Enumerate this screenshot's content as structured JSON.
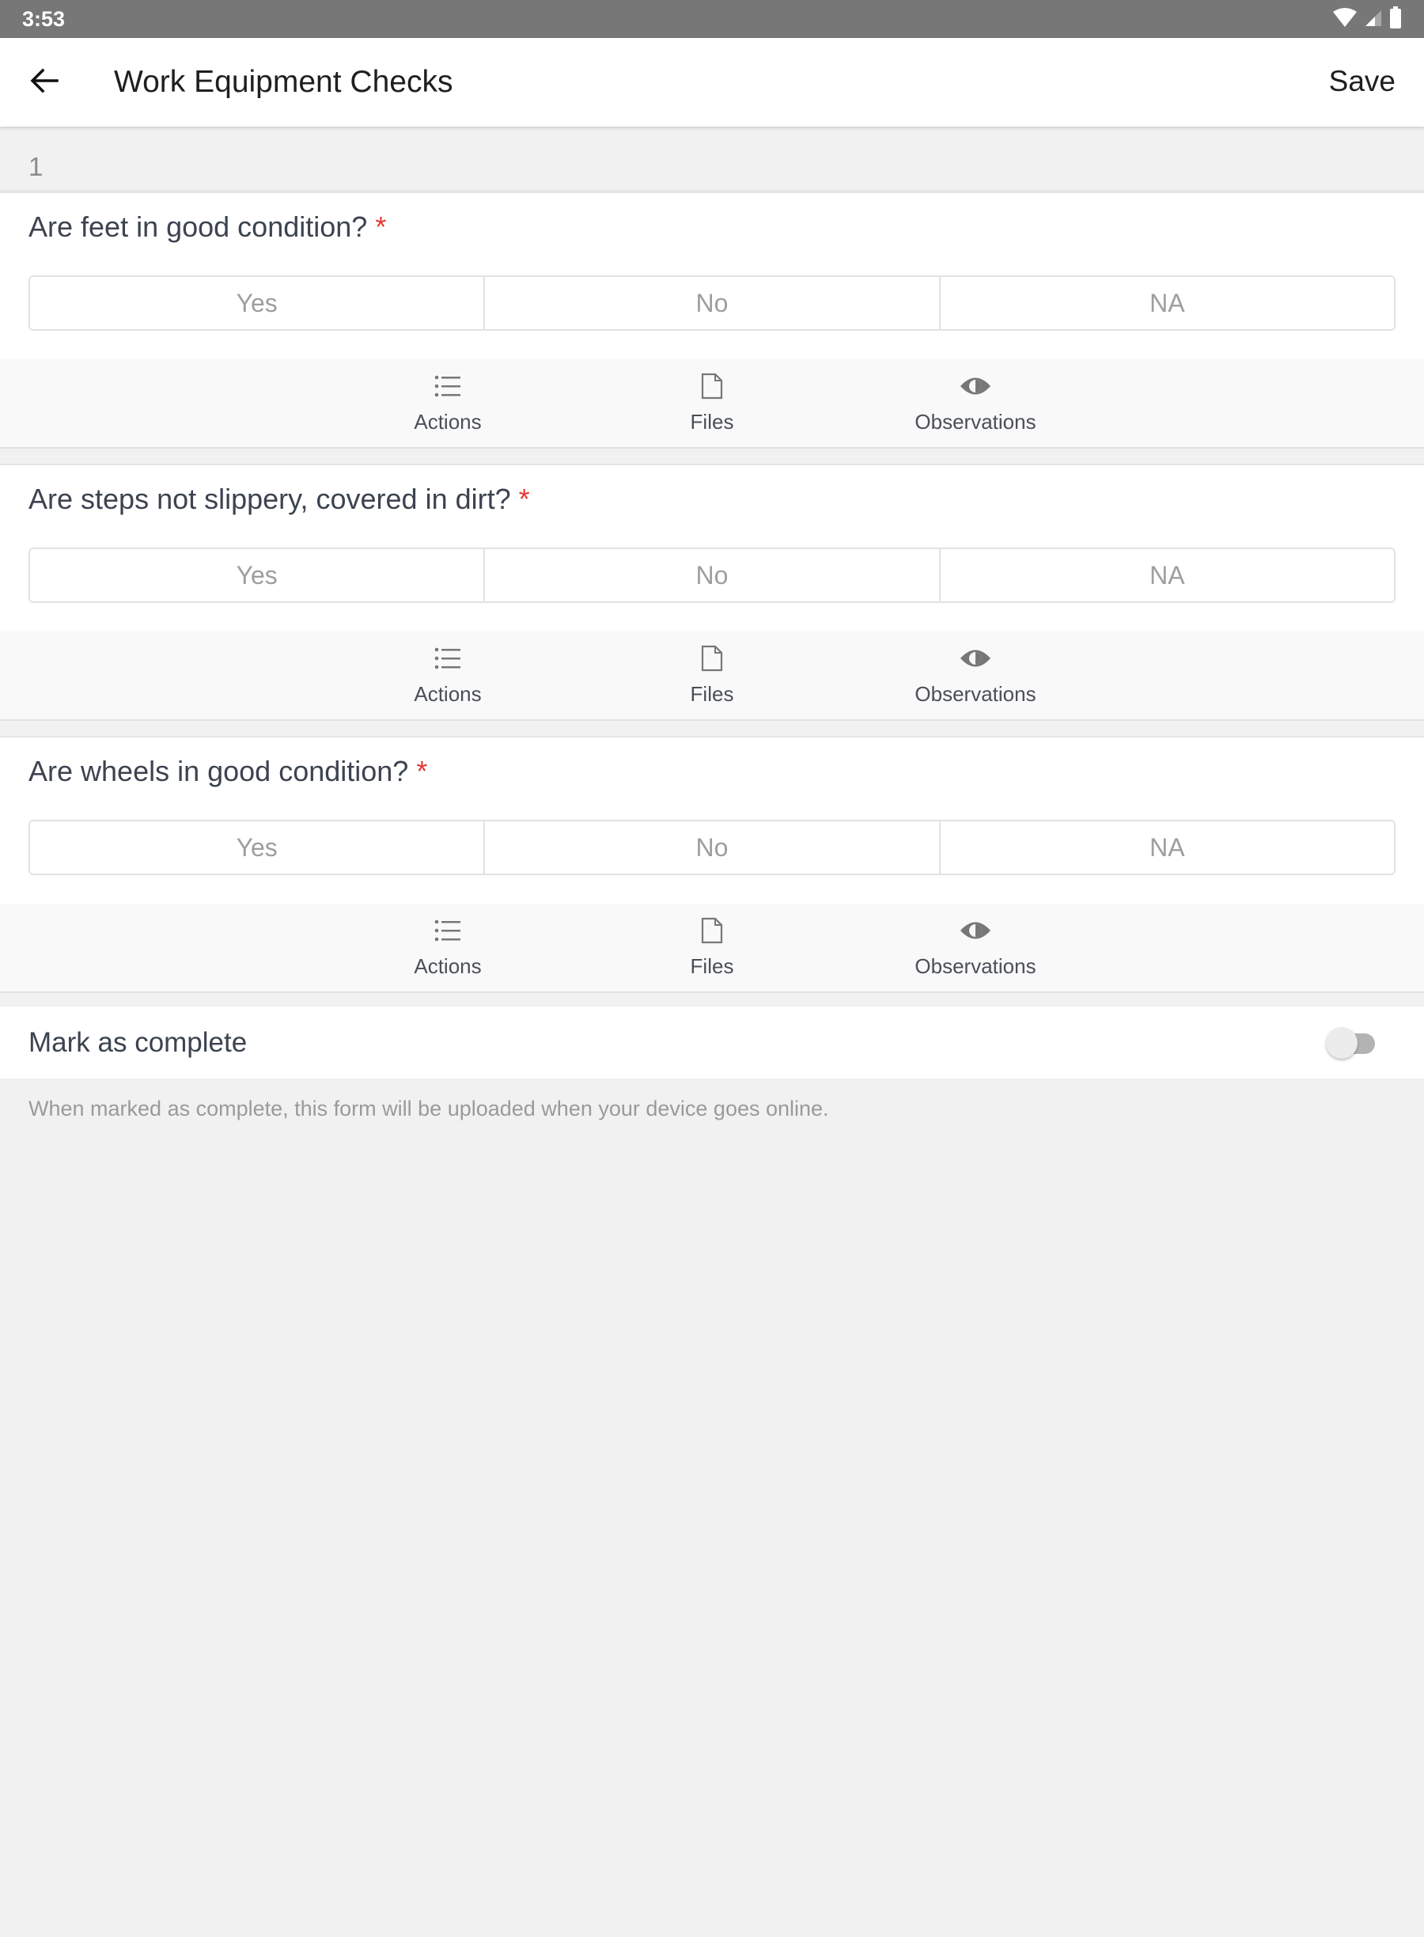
{
  "status_bar": {
    "time": "3:53",
    "icons": [
      "wifi-icon",
      "cell-signal-icon",
      "battery-icon"
    ]
  },
  "app_bar": {
    "back_icon": "arrow-left-icon",
    "title": "Work Equipment Checks",
    "save_label": "Save"
  },
  "section": {
    "number": "1"
  },
  "questions": [
    {
      "text": "Are feet in good condition?",
      "required_marker": "*",
      "options": [
        "Yes",
        "No",
        "NA"
      ],
      "actions": [
        {
          "label": "Actions",
          "icon": "list-icon"
        },
        {
          "label": "Files",
          "icon": "file-icon"
        },
        {
          "label": "Observations",
          "icon": "eye-icon"
        }
      ]
    },
    {
      "text": "Are steps not slippery, covered in dirt?",
      "required_marker": "*",
      "options": [
        "Yes",
        "No",
        "NA"
      ],
      "actions": [
        {
          "label": "Actions",
          "icon": "list-icon"
        },
        {
          "label": "Files",
          "icon": "file-icon"
        },
        {
          "label": "Observations",
          "icon": "eye-icon"
        }
      ]
    },
    {
      "text": "Are wheels in good condition?",
      "required_marker": "*",
      "options": [
        "Yes",
        "No",
        "NA"
      ],
      "actions": [
        {
          "label": "Actions",
          "icon": "list-icon"
        },
        {
          "label": "Files",
          "icon": "file-icon"
        },
        {
          "label": "Observations",
          "icon": "eye-icon"
        }
      ]
    }
  ],
  "complete": {
    "label": "Mark as complete",
    "toggle_on": false,
    "note": "When marked as complete, this form will be uploaded when your device goes online."
  },
  "colors": {
    "status_bar": "#777777",
    "required": "#e53935",
    "question_text": "#3c4350",
    "option_text": "#9e9e9e"
  }
}
